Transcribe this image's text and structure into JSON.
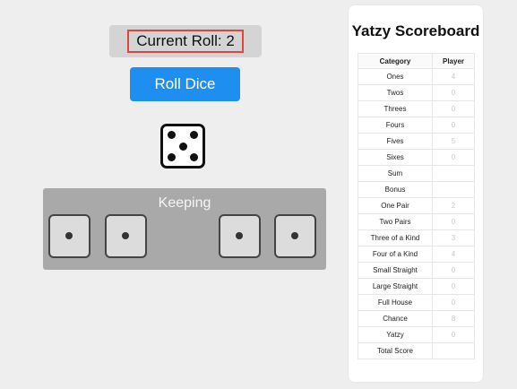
{
  "current_roll": {
    "label": "Current Roll: 2"
  },
  "roll_button": {
    "label": "Roll Dice"
  },
  "rolled_die": {
    "value": 5
  },
  "keeping": {
    "label": "Keeping",
    "dice": [
      1,
      1,
      1,
      1
    ]
  },
  "scoreboard": {
    "title": "Yatzy Scoreboard",
    "headers": {
      "category": "Category",
      "player": "Player"
    },
    "rows": [
      {
        "category": "Ones",
        "score": "4"
      },
      {
        "category": "Twos",
        "score": "0"
      },
      {
        "category": "Threes",
        "score": "0"
      },
      {
        "category": "Fours",
        "score": "0"
      },
      {
        "category": "Fives",
        "score": "5"
      },
      {
        "category": "Sixes",
        "score": "0"
      },
      {
        "category": "Sum",
        "score": ""
      },
      {
        "category": "Bonus",
        "score": ""
      },
      {
        "category": "One Pair",
        "score": "2"
      },
      {
        "category": "Two Pairs",
        "score": "0"
      },
      {
        "category": "Three of a Kind",
        "score": "3"
      },
      {
        "category": "Four of a Kind",
        "score": "4"
      },
      {
        "category": "Small Straight",
        "score": "0"
      },
      {
        "category": "Large Straight",
        "score": "0"
      },
      {
        "category": "Full House",
        "score": "0"
      },
      {
        "category": "Chance",
        "score": "8"
      },
      {
        "category": "Yatzy",
        "score": "0"
      },
      {
        "category": "Total Score",
        "score": ""
      }
    ]
  },
  "colors": {
    "accent": "#1f8ef1",
    "highlight_border": "#e0443a",
    "panel": "#a9a9a9",
    "background": "#eeeeee"
  }
}
